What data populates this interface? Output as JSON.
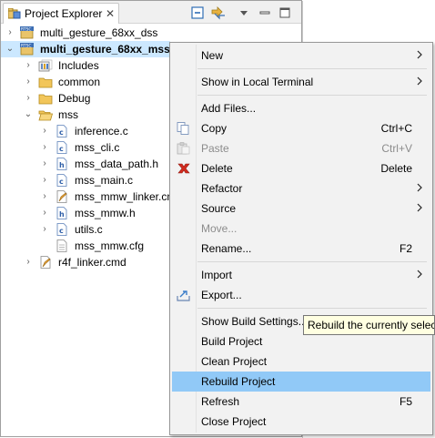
{
  "view": {
    "tab_title": "Project Explorer",
    "tab_close_glyph": "✕",
    "toolbar_icons": [
      "collapse-all-icon",
      "link-with-editor-icon",
      "view-menu-icon",
      "minimize-icon",
      "maximize-icon"
    ]
  },
  "tree": [
    {
      "label": "multi_gesture_68xx_dss",
      "icon": "rtsc-project-icon",
      "twisty": "›",
      "depth": 0,
      "selected": false
    },
    {
      "label": "multi_gesture_68xx_mss",
      "icon": "rtsc-project-icon",
      "twisty": "⌄",
      "depth": 0,
      "selected": true
    },
    {
      "label": "Includes",
      "icon": "includes-icon",
      "twisty": "›",
      "depth": 1,
      "selected": false
    },
    {
      "label": "common",
      "icon": "folder-icon",
      "twisty": "›",
      "depth": 1,
      "selected": false
    },
    {
      "label": "Debug",
      "icon": "folder-icon",
      "twisty": "›",
      "depth": 1,
      "selected": false
    },
    {
      "label": "mss",
      "icon": "folder-open-icon",
      "twisty": "⌄",
      "depth": 1,
      "selected": false
    },
    {
      "label": "inference.c",
      "icon": "c-file-icon",
      "twisty": "›",
      "depth": 2,
      "selected": false
    },
    {
      "label": "mss_cli.c",
      "icon": "c-file-icon",
      "twisty": "›",
      "depth": 2,
      "selected": false
    },
    {
      "label": "mss_data_path.h",
      "icon": "h-file-icon",
      "twisty": "›",
      "depth": 2,
      "selected": false
    },
    {
      "label": "mss_main.c",
      "icon": "c-file-icon",
      "twisty": "›",
      "depth": 2,
      "selected": false
    },
    {
      "label": "mss_mmw_linker.cmd",
      "icon": "linker-file-icon",
      "twisty": "›",
      "depth": 2,
      "selected": false
    },
    {
      "label": "mss_mmw.h",
      "icon": "h-file-icon",
      "twisty": "›",
      "depth": 2,
      "selected": false
    },
    {
      "label": "utils.c",
      "icon": "c-file-icon",
      "twisty": "›",
      "depth": 2,
      "selected": false
    },
    {
      "label": "mss_mmw.cfg",
      "icon": "cfg-file-icon",
      "twisty": "",
      "depth": 2,
      "selected": false
    },
    {
      "label": "r4f_linker.cmd",
      "icon": "linker-file-icon",
      "twisty": "›",
      "depth": 1,
      "selected": false
    }
  ],
  "context_menu": {
    "items": [
      {
        "label": "New",
        "accel": "",
        "submenu": true,
        "enabled": true,
        "icon": "",
        "highlighted": false
      },
      {
        "separator": true
      },
      {
        "label": "Show in Local Terminal",
        "accel": "",
        "submenu": true,
        "enabled": true,
        "icon": "",
        "highlighted": false
      },
      {
        "separator": true
      },
      {
        "label": "Add Files...",
        "accel": "",
        "submenu": false,
        "enabled": true,
        "icon": "",
        "highlighted": false
      },
      {
        "label": "Copy",
        "accel": "Ctrl+C",
        "submenu": false,
        "enabled": true,
        "icon": "copy-icon",
        "highlighted": false
      },
      {
        "label": "Paste",
        "accel": "Ctrl+V",
        "submenu": false,
        "enabled": false,
        "icon": "paste-icon",
        "highlighted": false
      },
      {
        "label": "Delete",
        "accel": "Delete",
        "submenu": false,
        "enabled": true,
        "icon": "delete-icon",
        "highlighted": false
      },
      {
        "label": "Refactor",
        "accel": "",
        "submenu": true,
        "enabled": true,
        "icon": "",
        "highlighted": false
      },
      {
        "label": "Source",
        "accel": "",
        "submenu": true,
        "enabled": true,
        "icon": "",
        "highlighted": false
      },
      {
        "label": "Move...",
        "accel": "",
        "submenu": false,
        "enabled": false,
        "icon": "",
        "highlighted": false
      },
      {
        "label": "Rename...",
        "accel": "F2",
        "submenu": false,
        "enabled": true,
        "icon": "",
        "highlighted": false
      },
      {
        "separator": true
      },
      {
        "label": "Import",
        "accel": "",
        "submenu": true,
        "enabled": true,
        "icon": "",
        "highlighted": false
      },
      {
        "label": "Export...",
        "accel": "",
        "submenu": false,
        "enabled": true,
        "icon": "export-icon",
        "highlighted": false
      },
      {
        "separator": true
      },
      {
        "label": "Show Build Settings...",
        "accel": "",
        "submenu": false,
        "enabled": true,
        "icon": "",
        "highlighted": false
      },
      {
        "label": "Build Project",
        "accel": "",
        "submenu": false,
        "enabled": true,
        "icon": "",
        "highlighted": false
      },
      {
        "label": "Clean Project",
        "accel": "",
        "submenu": false,
        "enabled": true,
        "icon": "",
        "highlighted": false
      },
      {
        "label": "Rebuild Project",
        "accel": "",
        "submenu": false,
        "enabled": true,
        "icon": "",
        "highlighted": true
      },
      {
        "label": "Refresh",
        "accel": "F5",
        "submenu": false,
        "enabled": true,
        "icon": "refresh-icon",
        "highlighted": false
      },
      {
        "label": "Close Project",
        "accel": "",
        "submenu": false,
        "enabled": true,
        "icon": "",
        "highlighted": false
      }
    ]
  },
  "tooltip": {
    "text": "Rebuild the currently selected"
  },
  "colors": {
    "selection": "#cce8ff",
    "menu_highlight": "#91c9f7",
    "menu_bg": "#f2f2f2",
    "tooltip_bg": "#ffffe1"
  }
}
